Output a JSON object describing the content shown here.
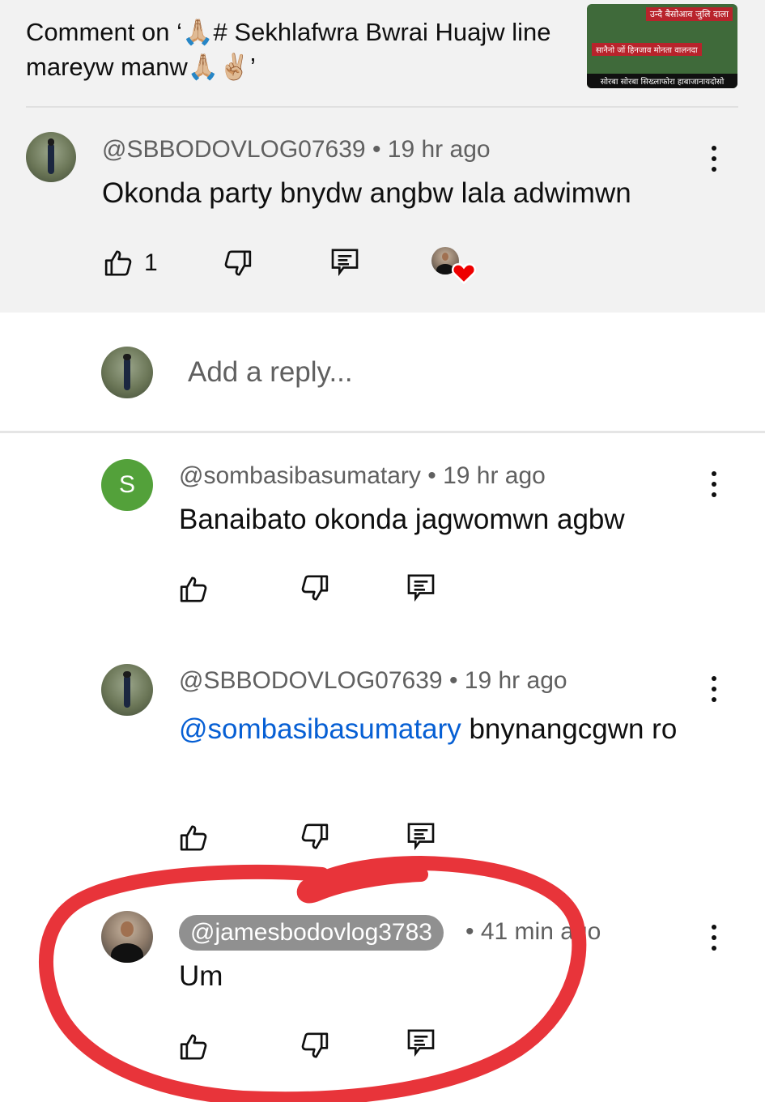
{
  "header": {
    "title": "Comment on ‘🙏🏼# Sekhlafwra Bwrai Huajw line mareyw manw🙏🏼✌🏼’",
    "thumbnail_text": [
      "उन्दै बैसोआव जुलि दाला",
      "सानैनो जों हिनजाव मोनता वालनदा",
      "सोरबा सोरबा सिख्लाफोरा हाबाजानायदोसो"
    ]
  },
  "parent_comment": {
    "handle": "@SBBODOVLOG07639",
    "time": "19 hr ago",
    "text": "Okonda party bnydw angbw lala adwimwn",
    "likes": "1"
  },
  "reply_box": {
    "placeholder": "Add a reply..."
  },
  "replies": [
    {
      "handle": "@sombasibasumatary",
      "time": "19 hr ago",
      "avatar_letter": "S",
      "text": "Banaibato okonda jagwomwn agbw"
    },
    {
      "handle": "@SBBODOVLOG07639",
      "time": "19 hr ago",
      "mention": "@sombasibasumatary",
      "text": "bnynangcgwn ro"
    },
    {
      "handle": "@jamesbodovlog3783",
      "time": "41 min ago",
      "text": "Um"
    }
  ],
  "icons": [
    "like-icon",
    "dislike-icon",
    "reply-icon",
    "more-vert-icon",
    "creator-heart-icon"
  ],
  "colors": {
    "panel": "#f2f2f2",
    "mention": "#065fd4",
    "annotation": "#e8343a",
    "letter_avatar": "#53a13a"
  }
}
